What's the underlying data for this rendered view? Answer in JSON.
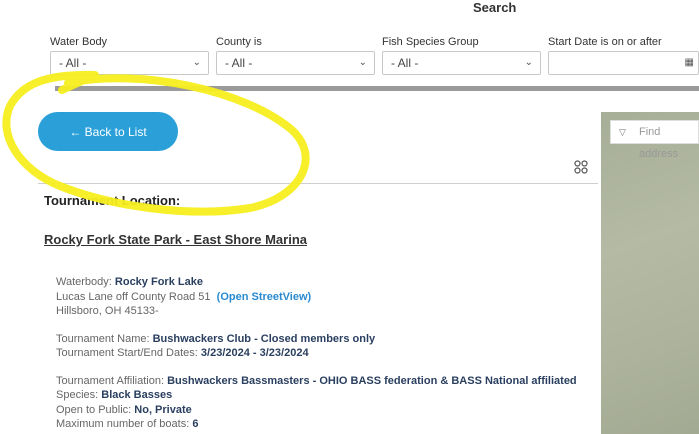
{
  "header": {
    "search_title": "Search"
  },
  "filters": [
    {
      "label": "Water Body",
      "value": "- All -"
    },
    {
      "label": "County is",
      "value": "- All -"
    },
    {
      "label": "Fish Species Group",
      "value": "- All -"
    },
    {
      "label": "Start Date is on or after",
      "value": ""
    }
  ],
  "actions": {
    "back_label": "← Back to List"
  },
  "section": {
    "title": "Tournament Location:"
  },
  "location": {
    "name": "Rocky Fork State Park - East Shore Marina"
  },
  "address": {
    "waterbody_label": "Waterbody: ",
    "waterbody_value": "Rocky Fork Lake",
    "street": "Lucas Lane off County Road 51",
    "streetview_link": "(Open StreetView)",
    "city": "Hillsboro, OH  45133-"
  },
  "tournament": {
    "name_label": "Tournament Name: ",
    "name_value": "Bushwackers Club - Closed members only",
    "dates_label": "Tournament Start/End Dates: ",
    "dates_value": "3/23/2024 - 3/23/2024",
    "affiliation_label": "Tournament Affiliation: ",
    "affiliation_value": "Bushwackers Bassmasters - OHIO BASS federation & BASS National affiliated",
    "species_label": "Species: ",
    "species_value": "Black Basses",
    "public_label": "Open to Public: ",
    "public_value": "No, Private",
    "boats_label": "Maximum number of boats: ",
    "boats_value": "6"
  },
  "map": {
    "search_placeholder": "Find address"
  },
  "colors": {
    "accent": "#2a9fd8",
    "highlight": "#f5ee1e",
    "link": "#2a8ad0"
  }
}
